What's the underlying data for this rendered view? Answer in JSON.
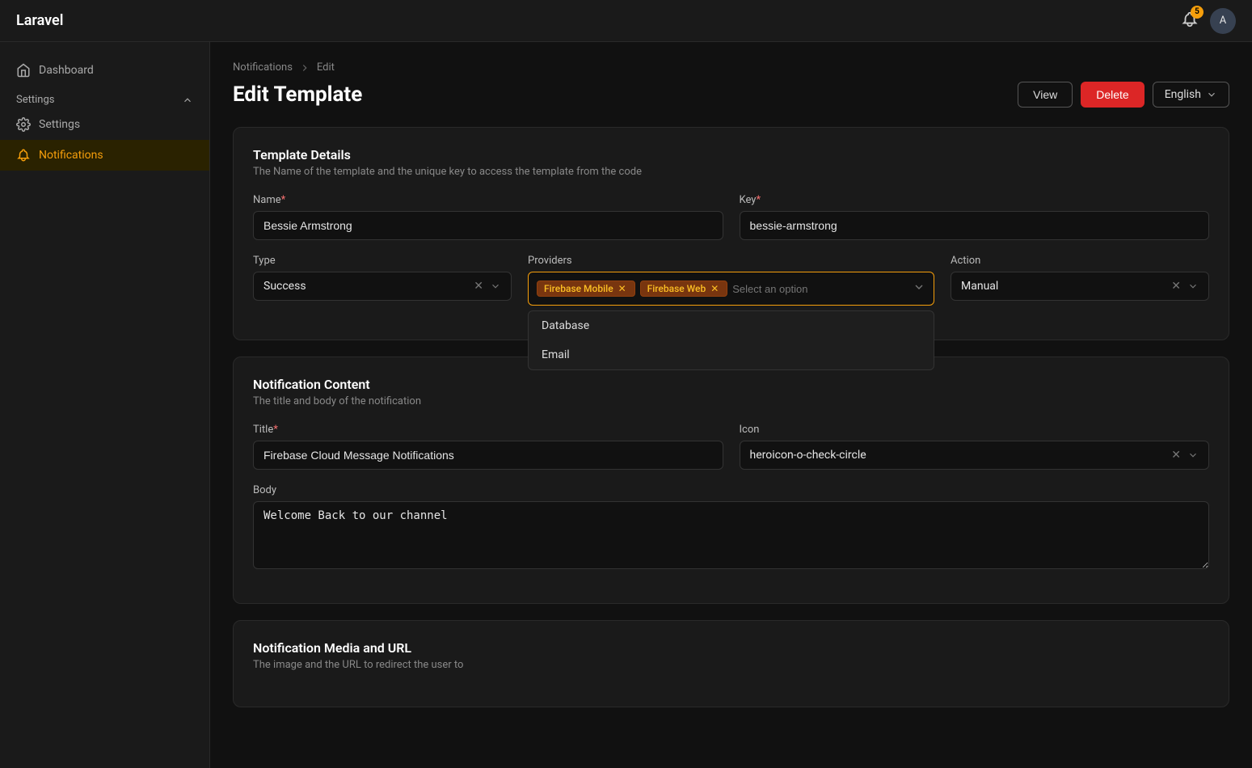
{
  "app": {
    "brand": "Laravel",
    "notification_count": "5",
    "user_initial": "A"
  },
  "sidebar": {
    "dashboard_label": "Dashboard",
    "settings_section_label": "Settings",
    "settings_item_label": "Settings",
    "notifications_item_label": "Notifications"
  },
  "breadcrumb": {
    "parent": "Notifications",
    "current": "Edit"
  },
  "page": {
    "title": "Edit Template",
    "view_label": "View",
    "delete_label": "Delete",
    "lang_label": "English"
  },
  "template_details": {
    "section_title": "Template Details",
    "section_subtitle": "The Name of the template and the unique key to access the template from the code",
    "name_label": "Name",
    "name_value": "Bessie Armstrong",
    "key_label": "Key",
    "key_value": "bessie-armstrong",
    "type_label": "Type",
    "type_value": "Success",
    "providers_label": "Providers",
    "tag1_label": "Firebase Mobile",
    "tag2_label": "Firebase Web",
    "select_placeholder": "Select an option",
    "action_label": "Action",
    "action_value": "Manual",
    "dropdown_item1": "Database",
    "dropdown_item2": "Email"
  },
  "notification_content": {
    "section_title": "Notification Content",
    "section_subtitle": "The title and body of the notification",
    "title_label": "Title",
    "title_value": "Firebase Cloud Message Notifications",
    "icon_label": "Icon",
    "icon_value": "heroicon-o-check-circle",
    "body_label": "Body",
    "body_value": "Welcome Back to our channel"
  },
  "notification_media": {
    "section_title": "Notification Media and URL",
    "section_subtitle": "The image and the URL to redirect the user to"
  }
}
